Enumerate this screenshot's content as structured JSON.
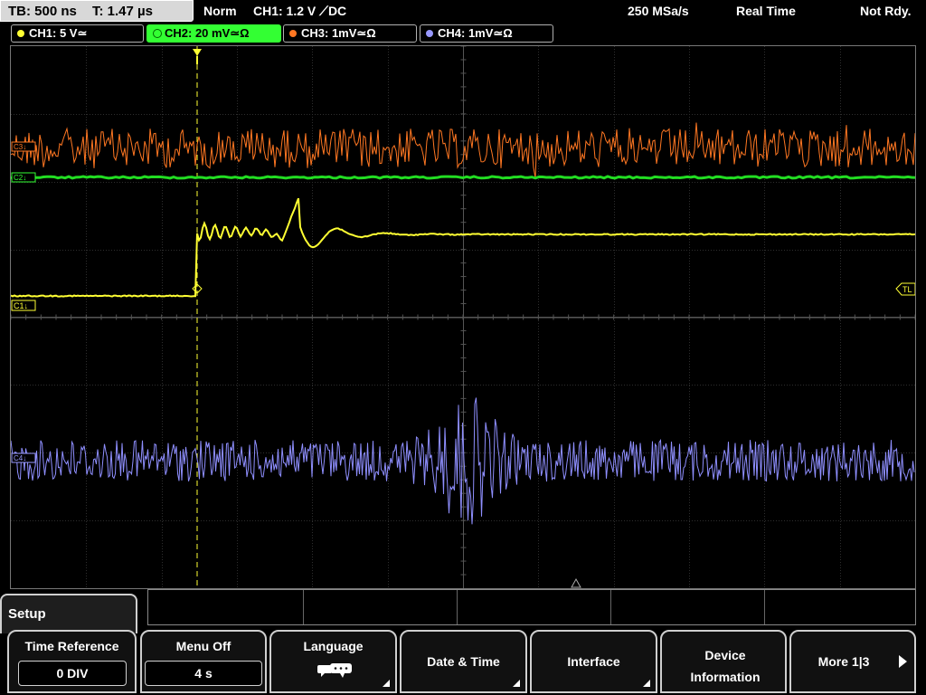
{
  "status": {
    "timebase": "TB: 500 ns",
    "trigger_time": "T: 1.47 µs",
    "trigger_mode": "Norm",
    "trigger_source": "CH1: 1.2 V ⟋DC",
    "sample_rate": "250 MSa/s",
    "acq_mode": "Real Time",
    "trig_state": "Not Rdy."
  },
  "channels": [
    {
      "label": "CH1: 5 V≃",
      "color": "#ffff33",
      "active": false
    },
    {
      "label": "CH2: 20 mV≃Ω",
      "color": "#33ff33",
      "active": true
    },
    {
      "label": "CH3: 1mV≃Ω",
      "color": "#ff7722",
      "active": false
    },
    {
      "label": "CH4: 1mV≃Ω",
      "color": "#9999ff",
      "active": false
    }
  ],
  "markers": {
    "c1": "C1↓",
    "c2": "C2↓",
    "c3": "C3↓",
    "c4": "C4↓",
    "trigger_level": "TL"
  },
  "menu": {
    "title": "Setup",
    "softkeys": [
      {
        "label": "Time Reference",
        "value": "0 DIV"
      },
      {
        "label": "Menu Off",
        "value": "4 s"
      },
      {
        "label": "Language",
        "icon": "language-icon"
      },
      {
        "label": "Date & Time"
      },
      {
        "label": "Interface"
      },
      {
        "label": "Device Information"
      },
      {
        "label": "More 1|3"
      }
    ]
  }
}
